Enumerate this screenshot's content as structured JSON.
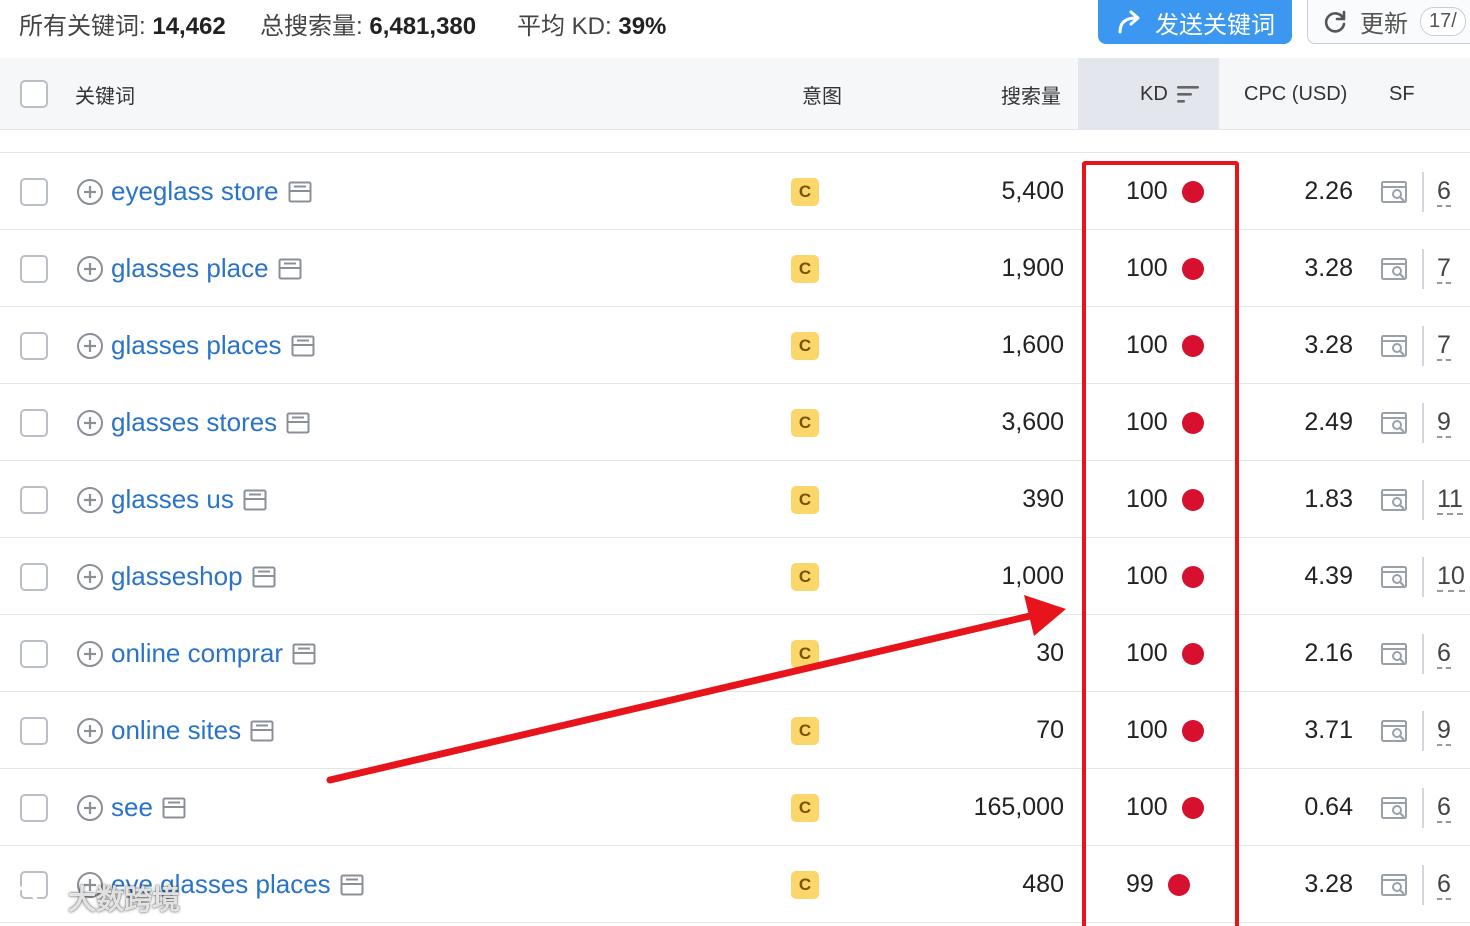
{
  "summary": {
    "all_keywords_label": "所有关键词:",
    "all_keywords_value": "14,462",
    "total_volume_label": "总搜索量:",
    "total_volume_value": "6,481,380",
    "avg_kd_label": "平均 KD:",
    "avg_kd_value": "39%"
  },
  "toolbar": {
    "send_keywords_label": "发送关键词",
    "refresh_label": "更新",
    "refresh_count": "17/"
  },
  "columns": {
    "keyword": "关键词",
    "intent": "意图",
    "volume": "搜索量",
    "kd": "KD",
    "cpc": "CPC (USD)",
    "sf": "SF"
  },
  "rows": [
    {
      "keyword": "eyeglass store",
      "intent": "C",
      "volume": "5,400",
      "kd": "100",
      "cpc": "2.26",
      "sf": "6"
    },
    {
      "keyword": "glasses place",
      "intent": "C",
      "volume": "1,900",
      "kd": "100",
      "cpc": "3.28",
      "sf": "7"
    },
    {
      "keyword": "glasses places",
      "intent": "C",
      "volume": "1,600",
      "kd": "100",
      "cpc": "3.28",
      "sf": "7"
    },
    {
      "keyword": "glasses stores",
      "intent": "C",
      "volume": "3,600",
      "kd": "100",
      "cpc": "2.49",
      "sf": "9"
    },
    {
      "keyword": "glasses us",
      "intent": "C",
      "volume": "390",
      "kd": "100",
      "cpc": "1.83",
      "sf": "11"
    },
    {
      "keyword": "glasseshop",
      "intent": "C",
      "volume": "1,000",
      "kd": "100",
      "cpc": "4.39",
      "sf": "10"
    },
    {
      "keyword": "online comprar",
      "intent": "C",
      "volume": "30",
      "kd": "100",
      "cpc": "2.16",
      "sf": "6"
    },
    {
      "keyword": "online sites",
      "intent": "C",
      "volume": "70",
      "kd": "100",
      "cpc": "3.71",
      "sf": "9"
    },
    {
      "keyword": "see",
      "intent": "C",
      "volume": "165,000",
      "kd": "100",
      "cpc": "0.64",
      "sf": "6"
    },
    {
      "keyword": "eye glasses places",
      "intent": "C",
      "volume": "480",
      "kd": "99",
      "cpc": "3.28",
      "sf": "6"
    }
  ],
  "colors": {
    "kd_very_hard": "#d6102e",
    "intent_commercial": "#fbd66b",
    "link": "#2a73c9",
    "annotation_red": "#e8141c",
    "send_button": "#3b97f0"
  },
  "icons": {
    "send": "share-arrow-icon",
    "refresh": "refresh-icon",
    "sort": "sort-desc-icon",
    "add": "plus-circle-icon",
    "serp": "serp-snapshot-icon",
    "sf_preview": "search-preview-icon"
  },
  "watermark": {
    "text": "大数跨境"
  }
}
